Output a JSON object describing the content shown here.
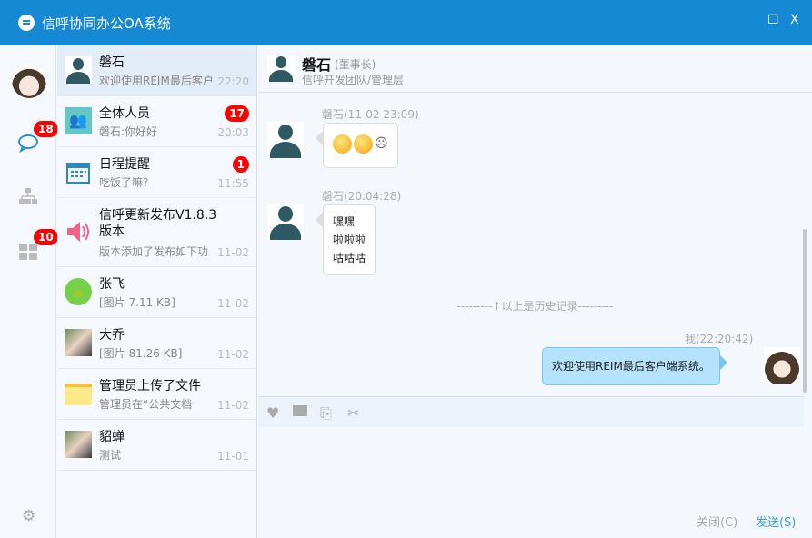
{
  "window": {
    "title": "信呼协同办公OA系统",
    "maximize": "☐",
    "close": "X"
  },
  "rail": {
    "chat_badge": "18",
    "apps_badge": "10"
  },
  "conversations": [
    {
      "name": "磐石",
      "preview": "欢迎使用REIM最后客户",
      "time": "22:20",
      "badge": null,
      "icon": "person-avatar"
    },
    {
      "name": "全体人员",
      "preview": "磐石:你好好",
      "time": "20:03",
      "badge": "17",
      "icon": "group-icon"
    },
    {
      "name": "日程提醒",
      "preview": "吃饭了嘛？",
      "time": "11:55",
      "badge": "1",
      "icon": "calendar-icon"
    },
    {
      "name": "信呼更新发布V1.8.3版本",
      "preview": "版本添加了发布如下功",
      "time": "11-02",
      "badge": null,
      "icon": "speaker-icon"
    },
    {
      "name": "张飞",
      "preview": "[图片 7.11 KB]",
      "time": "11-02",
      "badge": null,
      "icon": "cup-avatar"
    },
    {
      "name": "大乔",
      "preview": "[图片 81.26 KB]",
      "time": "11-02",
      "badge": null,
      "icon": "photo-avatar"
    },
    {
      "name": "管理员上传了文件",
      "preview": "管理员在“公共文档",
      "time": "11-02",
      "badge": null,
      "icon": "folder-icon"
    },
    {
      "name": "貂蝉",
      "preview": "测试",
      "time": "11-01",
      "badge": null,
      "icon": "photo-avatar"
    }
  ],
  "chat": {
    "name": "磐石",
    "role": "(董事长)",
    "dept": "信呼开发团队/管理层",
    "messages": [
      {
        "sender": "磐石(11-02 23:09)",
        "text": "",
        "emoji": true
      },
      {
        "sender": "磐石(20:04:28)",
        "lines": [
          "嘿嘿",
          "啦啦啦",
          "咕咕咕"
        ]
      },
      {
        "sender": "我(22:20:42)",
        "text": "欢迎使用REIM最后客户端系统。"
      }
    ],
    "history_divider": "---------↑以上是历史记录---------",
    "close_label": "关闭(C)",
    "send_label": "发送(S)"
  },
  "colors": {
    "titlebar": "#1589d4",
    "badge": "#ff0000",
    "my_bubble": "#b5e2fc"
  }
}
